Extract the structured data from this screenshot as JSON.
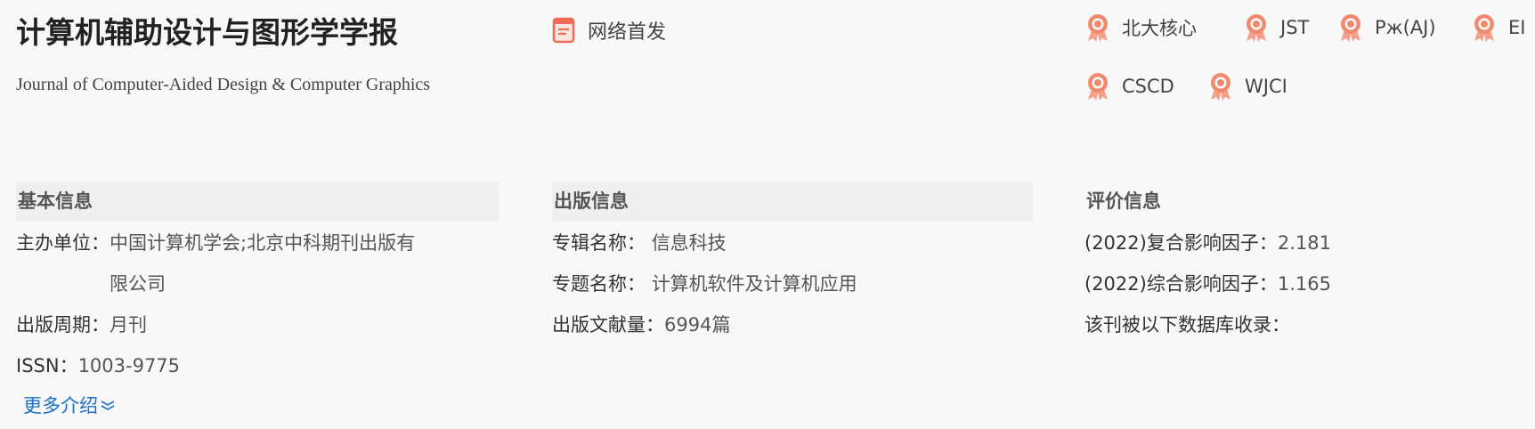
{
  "journal": {
    "title_cn": "计算机辅助设计与图形学学报",
    "title_en": "Journal of Computer-Aided Design & Computer Graphics",
    "network_first": "网络首发"
  },
  "badges": [
    "北大核心",
    "JST",
    "Рж(AJ)",
    "EI",
    "CSCD",
    "WJCI"
  ],
  "basic_info": {
    "heading": "基本信息",
    "sponsor_label": "主办单位：",
    "sponsor_value": "中国计算机学会;北京中科期刊出版有限公司",
    "period_label": "出版周期：",
    "period_value": "月刊",
    "issn_label": "ISSN：",
    "issn_value": "1003-9775",
    "more": "更多介绍"
  },
  "publish_info": {
    "heading": "出版信息",
    "album_label": "专辑名称：",
    "album_value": "信息科技",
    "topic_label": "专题名称：",
    "topic_value": "计算机软件及计算机应用",
    "count_label": "出版文献量：",
    "count_value": "6994篇"
  },
  "eval_info": {
    "heading": "评价信息",
    "composite_label": "(2022)复合影响因子：",
    "composite_value": "2.181",
    "comprehensive_label": "(2022)综合影响因子：",
    "comprehensive_value": "1.165",
    "db_label": "该刊被以下数据库收录："
  },
  "colors": {
    "badge": "#f08a6f",
    "doc_icon": "#ef6b55",
    "link": "#1a6fc4"
  }
}
